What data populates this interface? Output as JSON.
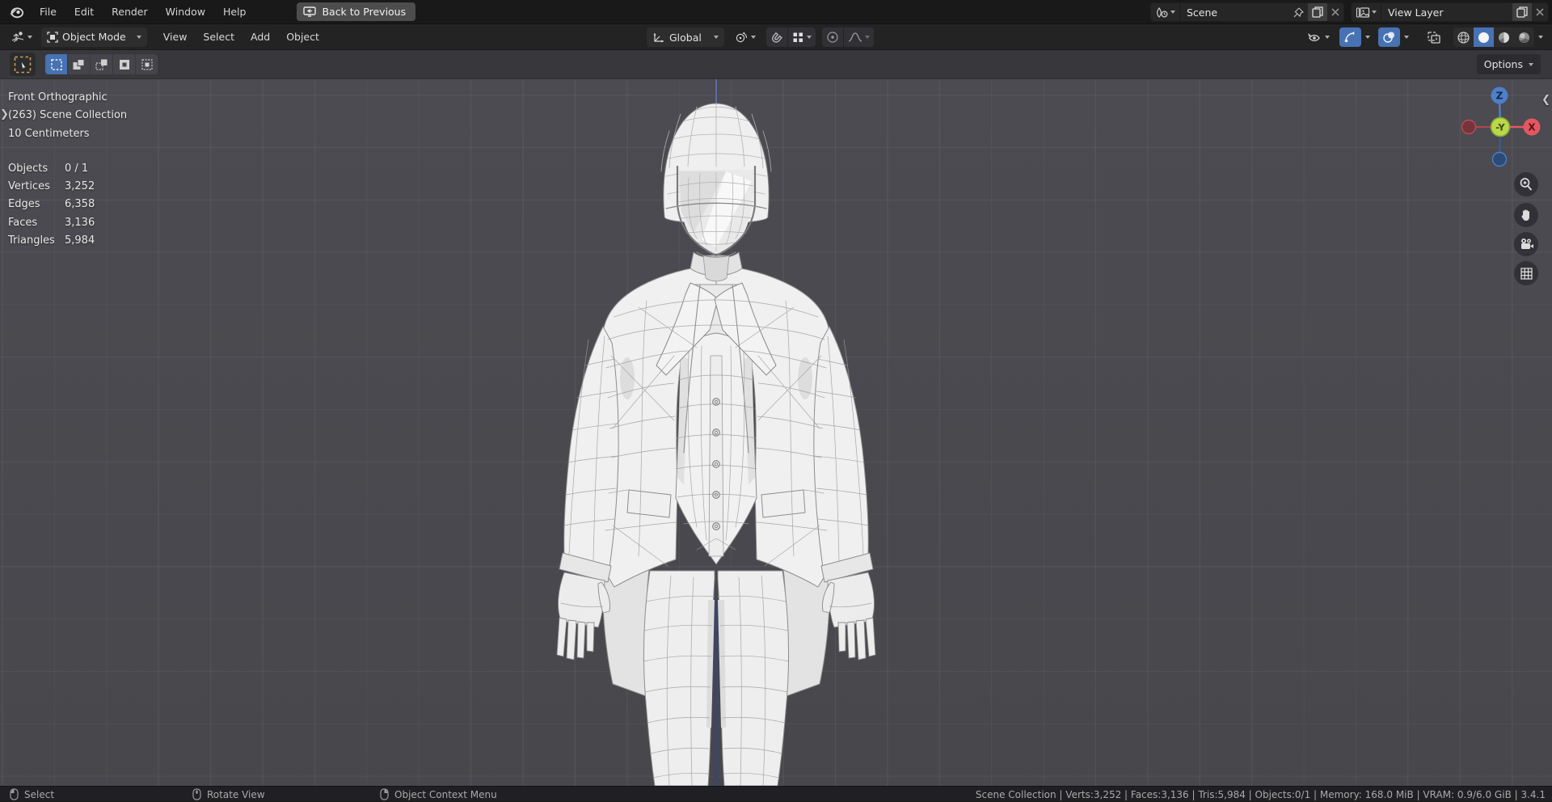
{
  "topbar": {
    "menus": [
      "File",
      "Edit",
      "Render",
      "Window",
      "Help"
    ],
    "back_button_label": "Back to Previous",
    "scene_selector": {
      "value": "Scene"
    },
    "view_layer_selector": {
      "value": "View Layer"
    }
  },
  "header": {
    "mode_select_value": "Object Mode",
    "menus": [
      "View",
      "Select",
      "Add",
      "Object"
    ],
    "orientation_value": "Global"
  },
  "tool_settings": {
    "options_label": "Options"
  },
  "viewport": {
    "overlay": {
      "view_label": "Front Orthographic",
      "collection_label": "(263) Scene Collection",
      "scale_label": "10 Centimeters",
      "stats": [
        {
          "label": "Objects",
          "value": "0 / 1"
        },
        {
          "label": "Vertices",
          "value": "3,252"
        },
        {
          "label": "Edges",
          "value": "6,358"
        },
        {
          "label": "Faces",
          "value": "3,136"
        },
        {
          "label": "Triangles",
          "value": "5,984"
        }
      ]
    },
    "gizmo": {
      "z": "Z",
      "y_neg": "-Y",
      "x": "X"
    }
  },
  "statusbar": {
    "hints": [
      {
        "label": "Select"
      },
      {
        "label": "Rotate View"
      },
      {
        "label": "Object Context Menu"
      }
    ],
    "info": "Scene Collection | Verts:3,252 | Faces:3,136 | Tris:5,984 | Objects:0/1 | Memory: 168.0 MiB | VRAM: 0.9/6.0 GiB | 3.4.1"
  },
  "colors": {
    "accent_blue": "#4772b3",
    "viewport_bg": "#4a4a50",
    "axis_x_red": "#e25862",
    "axis_y_green": "#b9d84a",
    "axis_z_blue": "#4e80c8",
    "tool_active_amber": "#d9a245"
  }
}
